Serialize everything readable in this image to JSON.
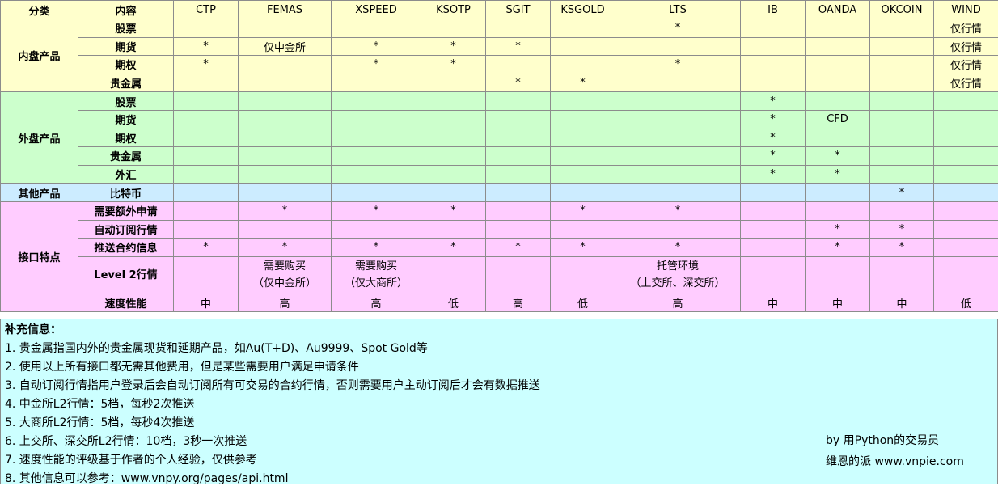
{
  "header": [
    "分类",
    "内容",
    "CTP",
    "FEMAS",
    "XSPEED",
    "KSOTP",
    "SGIT",
    "KSGOLD",
    "LTS",
    "IB",
    "OANDA",
    "OKCOIN",
    "WIND"
  ],
  "groups": [
    {
      "category": "内盘产品",
      "theme": "y",
      "rows": [
        {
          "label": "股票",
          "cells": [
            "",
            "",
            "",
            "",
            "",
            "",
            "*",
            "",
            "",
            "",
            "仅行情"
          ]
        },
        {
          "label": "期货",
          "cells": [
            "*",
            "仅中金所",
            "*",
            "*",
            "*",
            "",
            "",
            "",
            "",
            "",
            "仅行情"
          ]
        },
        {
          "label": "期权",
          "cells": [
            "*",
            "",
            "*",
            "*",
            "",
            "",
            "*",
            "",
            "",
            "",
            "仅行情"
          ]
        },
        {
          "label": "贵金属",
          "cells": [
            "",
            "",
            "",
            "",
            "*",
            "*",
            "",
            "",
            "",
            "",
            "仅行情"
          ]
        }
      ]
    },
    {
      "category": "外盘产品",
      "theme": "g",
      "rows": [
        {
          "label": "股票",
          "cells": [
            "",
            "",
            "",
            "",
            "",
            "",
            "",
            "*",
            "",
            "",
            ""
          ]
        },
        {
          "label": "期货",
          "cells": [
            "",
            "",
            "",
            "",
            "",
            "",
            "",
            "*",
            "CFD",
            "",
            ""
          ]
        },
        {
          "label": "期权",
          "cells": [
            "",
            "",
            "",
            "",
            "",
            "",
            "",
            "*",
            "",
            "",
            ""
          ]
        },
        {
          "label": "贵金属",
          "cells": [
            "",
            "",
            "",
            "",
            "",
            "",
            "",
            "*",
            "*",
            "",
            ""
          ]
        },
        {
          "label": "外汇",
          "cells": [
            "",
            "",
            "",
            "",
            "",
            "",
            "",
            "*",
            "*",
            "",
            ""
          ]
        }
      ]
    },
    {
      "category": "其他产品",
      "theme": "b",
      "rows": [
        {
          "label": "比特币",
          "cells": [
            "",
            "",
            "",
            "",
            "",
            "",
            "",
            "",
            "",
            "*",
            ""
          ]
        }
      ]
    },
    {
      "category": "接口特点",
      "theme": "p",
      "rows": [
        {
          "label": "需要额外申请",
          "cells": [
            "",
            "*",
            "*",
            "*",
            "",
            "*",
            "*",
            "",
            "",
            "",
            ""
          ]
        },
        {
          "label": "自动订阅行情",
          "cells": [
            "",
            "",
            "",
            "",
            "",
            "",
            "",
            "",
            "*",
            "*",
            ""
          ]
        },
        {
          "label": "推送合约信息",
          "cells": [
            "*",
            "*",
            "*",
            "*",
            "*",
            "*",
            "*",
            "",
            "*",
            "*",
            ""
          ]
        },
        {
          "label": "Level 2行情",
          "tall": true,
          "cells": [
            "",
            "需要购买\n（仅中金所）",
            "需要购买\n（仅大商所）",
            "",
            "",
            "",
            "托管环境\n（上交所、深交所）",
            "",
            "",
            "",
            ""
          ]
        },
        {
          "label": "速度性能",
          "cells": [
            "中",
            "高",
            "高",
            "低",
            "高",
            "低",
            "高",
            "中",
            "中",
            "中",
            "低"
          ]
        }
      ]
    }
  ],
  "notes": {
    "title": "补充信息：",
    "lines": [
      "1. 贵金属指国内外的贵金属现货和延期产品，如Au(T+D)、Au9999、Spot Gold等",
      "2. 使用以上所有接口都无需其他费用，但是某些需要用户满足申请条件",
      "3. 自动订阅行情指用户登录后会自动订阅所有可交易的合约行情，否则需要用户主动订阅后才会有数据推送",
      "4. 中金所L2行情：5档，每秒2次推送",
      "5. 大商所L2行情：5档，每秒4次推送",
      "6. 上交所、深交所L2行情：10档，3秒一次推送",
      "7. 速度性能的评级基于作者的个人经验，仅供参考",
      "8. 其他信息可以参考：www.vnpy.org/pages/api.html"
    ],
    "credit_1": "by 用Python的交易员",
    "credit_2": "维恩的派  www.vnpie.com"
  }
}
